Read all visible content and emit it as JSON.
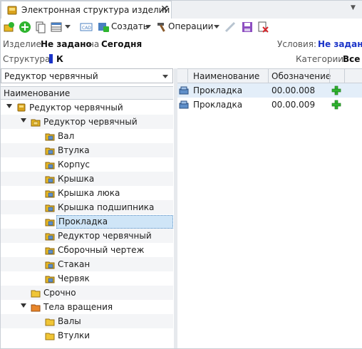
{
  "tab": {
    "title": "Электронная структура изделий",
    "close": "✕",
    "menu": "▼"
  },
  "toolbar": {
    "create_label": "Создать",
    "operations_label": "Операции",
    "cad_label": "CAD"
  },
  "info": {
    "item_label": "Изделие:",
    "item_value": "Не задано",
    "on_label": "на",
    "date_value": "Сегодня",
    "conditions_label": "Условия:",
    "conditions_value": "Не задано",
    "structure_label": "Структура:",
    "structure_value": "К",
    "categories_label": "Категории:",
    "categories_value": "Все"
  },
  "left": {
    "combo_value": "Редуктор червячный",
    "header": "Наименование",
    "nodes": [
      {
        "label": "Редуктор червячный"
      },
      {
        "label": "Редуктор червячный"
      },
      {
        "label": "Вал"
      },
      {
        "label": "Втулка"
      },
      {
        "label": "Корпус"
      },
      {
        "label": "Крышка"
      },
      {
        "label": "Крышка люка"
      },
      {
        "label": "Крышка подшипника"
      },
      {
        "label": "Прокладка"
      },
      {
        "label": "Редуктор червячный"
      },
      {
        "label": "Сборочный чертеж"
      },
      {
        "label": "Стакан"
      },
      {
        "label": "Червяк"
      },
      {
        "label": "Срочно"
      },
      {
        "label": "Тела вращения"
      },
      {
        "label": "Валы"
      },
      {
        "label": "Втулки"
      }
    ]
  },
  "grid": {
    "columns": [
      "Наименование",
      "Обозначение"
    ],
    "rows": [
      {
        "name": "Прокладка",
        "designation": "00.00.008"
      },
      {
        "name": "Прокладка",
        "designation": "00.00.009"
      }
    ]
  },
  "colors": {
    "accent_blue": "#1a33c8",
    "folder_yellow": "#e8b923",
    "plus_green": "#2fb52f"
  }
}
